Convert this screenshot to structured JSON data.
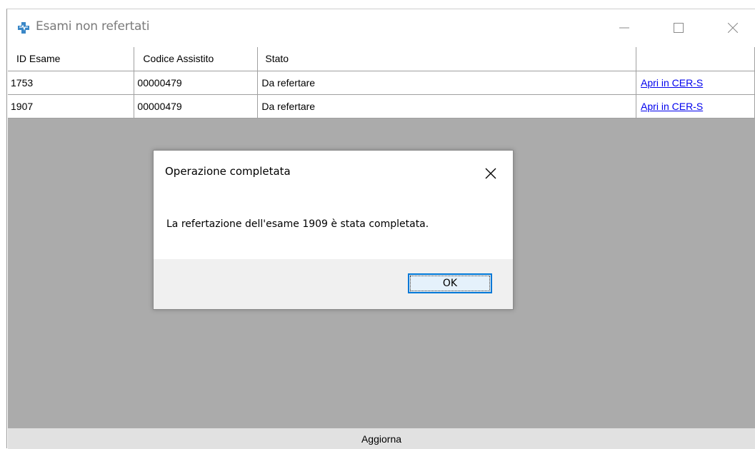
{
  "window": {
    "title": "Esami non refertati",
    "icons": {
      "app": "medical-cross-icon",
      "minimize": "minimize-icon",
      "maximize": "maximize-icon",
      "close": "close-icon"
    }
  },
  "grid": {
    "columns": [
      "ID Esame",
      "Codice Assistito",
      "Stato",
      ""
    ],
    "rows": [
      {
        "id": "1753",
        "codice": "00000479",
        "stato": "Da refertare",
        "link": "Apri in CER-S"
      },
      {
        "id": "1907",
        "codice": "00000479",
        "stato": "Da refertare",
        "link": "Apri in CER-S"
      }
    ]
  },
  "refresh_button": "Aggiorna",
  "dialog": {
    "title": "Operazione completata",
    "message": "La refertazione dell'esame 1909 è stata completata.",
    "ok_label": "OK"
  },
  "colors": {
    "accent": "#0078d7",
    "link": "#0000ee",
    "grid_background": "#ababab",
    "icon_blue": "#3a87c7"
  }
}
